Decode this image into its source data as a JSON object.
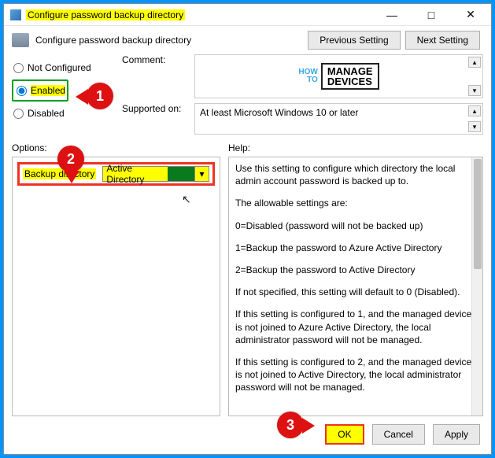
{
  "title": "Configure password backup directory",
  "header_title": "Configure password backup directory",
  "nav": {
    "prev": "Previous Setting",
    "next": "Next Setting"
  },
  "radios": {
    "not_configured": "Not Configured",
    "enabled": "Enabled",
    "disabled": "Disabled",
    "selected": "enabled"
  },
  "labels": {
    "comment": "Comment:",
    "supported": "Supported on:",
    "options": "Options:",
    "help": "Help:"
  },
  "supported_text": "At least Microsoft Windows 10 or later",
  "option": {
    "key": "Backup directory",
    "value": "Active Directory"
  },
  "brand": {
    "how": "HOW",
    "to": "TO",
    "manage": "MANAGE",
    "devices": "DEVICES"
  },
  "help": {
    "p1": "Use this setting to configure which directory the local admin account password is backed up to.",
    "p2": "The allowable settings are:",
    "p3": "0=Disabled (password will not be backed up)",
    "p4": "1=Backup the password to Azure Active Directory",
    "p5": "2=Backup the password to Active Directory",
    "p6": "If not specified, this setting will default to 0 (Disabled).",
    "p7": "If this setting is configured to 1, and the managed device is not joined to Azure Active Directory, the local administrator password will not be managed.",
    "p8": "If this setting is configured to 2, and the managed device is not joined to Active Directory, the local administrator password will not be managed."
  },
  "buttons": {
    "ok": "OK",
    "cancel": "Cancel",
    "apply": "Apply"
  },
  "callouts": {
    "c1": "1",
    "c2": "2",
    "c3": "3"
  }
}
